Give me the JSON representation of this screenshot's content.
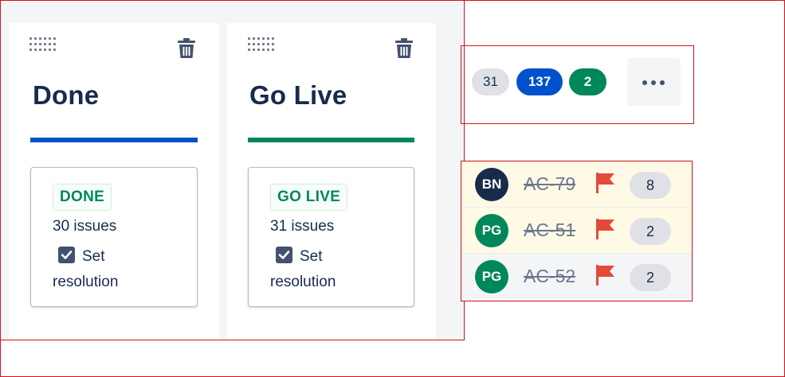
{
  "columns": [
    {
      "title": "Done",
      "bar_color": "#0052cc",
      "status_lozenge": "DONE",
      "issue_count": "30 issues",
      "set_resolution_label_line1": "Set",
      "set_resolution_label_line2": "resolution",
      "set_resolution_checked": true
    },
    {
      "title": "Go Live",
      "bar_color": "#00875a",
      "status_lozenge": "GO LIVE",
      "issue_count": "31 issues",
      "set_resolution_label_line1": "Set",
      "set_resolution_label_line2": "resolution",
      "set_resolution_checked": true
    }
  ],
  "count_badges": {
    "grey": "31",
    "blue": "137",
    "green": "2",
    "more_icon": "ellipsis-icon"
  },
  "issues": [
    {
      "avatar_initials": "BN",
      "avatar_color": "#172b4d",
      "key": "AC-79",
      "flagged": true,
      "estimate": "8"
    },
    {
      "avatar_initials": "PG",
      "avatar_color": "#00875a",
      "key": "AC-51",
      "flagged": true,
      "estimate": "2"
    },
    {
      "avatar_initials": "PG",
      "avatar_color": "#00875a",
      "key": "AC-52",
      "flagged": true,
      "estimate": "2"
    }
  ],
  "colors": {
    "flag": "#e5493a",
    "lozenge_text": "#00875a",
    "highlight_frame": "#d0121b"
  }
}
